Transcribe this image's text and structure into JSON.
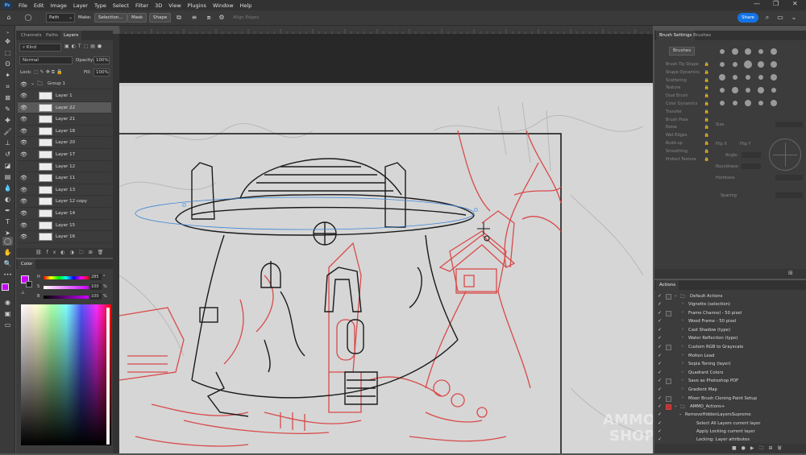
{
  "menu": {
    "logo": "Ps",
    "items": [
      "File",
      "Edit",
      "Image",
      "Layer",
      "Type",
      "Select",
      "Filter",
      "3D",
      "View",
      "Plugins",
      "Window",
      "Help"
    ]
  },
  "options": {
    "mode": "Path",
    "make_label": "Make:",
    "selection_btn": "Selection...",
    "mask_btn": "Mask",
    "shape_btn": "Shape",
    "align_edges": "Align Edges",
    "share": "Share"
  },
  "left_panel": {
    "tabs": [
      "Channels",
      "Paths",
      "Layers"
    ],
    "active_tab": "Layers",
    "kind_filter": "Kind",
    "blend_mode": "Normal",
    "opacity_label": "Opacity:",
    "opacity_value": "100%",
    "lock_label": "Lock:",
    "fill_label": "Fill:",
    "fill_value": "100%",
    "group_name": "Group 1",
    "layers": [
      {
        "name": "Layer 1",
        "visible": true,
        "selected": false
      },
      {
        "name": "Layer 22",
        "visible": true,
        "selected": true
      },
      {
        "name": "Layer 21",
        "visible": true,
        "selected": false
      },
      {
        "name": "Layer 18",
        "visible": true,
        "selected": false
      },
      {
        "name": "Layer 20",
        "visible": true,
        "selected": false
      },
      {
        "name": "Layer 17",
        "visible": true,
        "selected": false
      },
      {
        "name": "Layer 12",
        "visible": false,
        "selected": false
      },
      {
        "name": "Layer 11",
        "visible": true,
        "selected": false
      },
      {
        "name": "Layer 13",
        "visible": true,
        "selected": false
      },
      {
        "name": "Layer 12 copy",
        "visible": true,
        "selected": false
      },
      {
        "name": "Layer 14",
        "visible": true,
        "selected": false
      },
      {
        "name": "Layer 15",
        "visible": true,
        "selected": false
      },
      {
        "name": "Layer 16",
        "visible": true,
        "selected": false
      }
    ]
  },
  "color_panel": {
    "title": "Color",
    "h_label": "H",
    "h_value": "285",
    "h_unit": "°",
    "s_label": "S",
    "s_value": "100",
    "s_unit": "%",
    "b_label": "B",
    "b_value": "100",
    "b_unit": "%",
    "foreground": "#cc00ff",
    "hue_color": "#cc00ff"
  },
  "brush_settings": {
    "tabs": [
      "Brush Settings",
      "Brushes"
    ],
    "brushes_btn": "Brushes",
    "options": [
      "Brush Tip Shape",
      "Shape Dynamics",
      "Scattering",
      "Texture",
      "Dual Brush",
      "Color Dynamics",
      "Transfer",
      "Brush Pose",
      "Noise",
      "Wet Edges",
      "Build-up",
      "Smoothing",
      "Protect Texture"
    ],
    "size_label": "Size",
    "flip_x": "Flip X",
    "flip_y": "Flip Y",
    "angle_label": "Angle:",
    "roundness_label": "Roundness:",
    "hardness_label": "Hardness",
    "spacing_label": "Spacing"
  },
  "actions": {
    "title": "Actions",
    "set_name": "Default Actions",
    "items": [
      {
        "name": "Vignette (selection)",
        "has_box": false
      },
      {
        "name": "Frame Channel - 50 pixel",
        "has_box": true
      },
      {
        "name": "Wood Frame - 50 pixel",
        "has_box": false
      },
      {
        "name": "Cast Shadow (type)",
        "has_box": false
      },
      {
        "name": "Water Reflection (type)",
        "has_box": false
      },
      {
        "name": "Custom RGB to Grayscale",
        "has_box": true
      },
      {
        "name": "Molten Lead",
        "has_box": false
      },
      {
        "name": "Sepia Toning (layer)",
        "has_box": false
      },
      {
        "name": "Quadrant Colors",
        "has_box": false
      },
      {
        "name": "Save as Photoshop PDF",
        "has_box": true
      },
      {
        "name": "Gradient Map",
        "has_box": false
      },
      {
        "name": "Mixer Brush Cloning Paint Setup",
        "has_box": true
      }
    ],
    "set2_name": "AMMO_Actions+",
    "sub_name": "RemoveHiddenLayersSupreme",
    "sub_items": [
      "Select All Layers current layer",
      "Apply Locking current layer",
      "Locking: Layer attributes"
    ]
  },
  "watermark": [
    "AMMON",
    "SHOP"
  ],
  "colors": {
    "accent": "#1473e6",
    "sketch_red": "#d94a4a",
    "path_blue": "#3f86d6",
    "canvas_bg": "#d9d9d9"
  }
}
